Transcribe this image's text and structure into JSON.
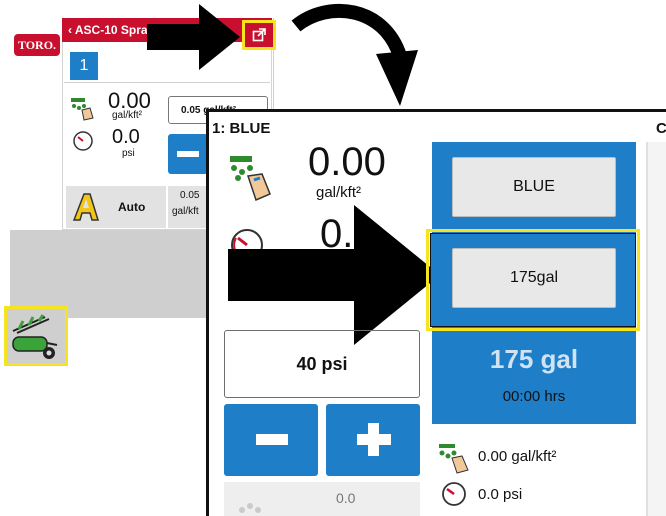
{
  "background_screen": {
    "logo_text": "TORO.",
    "header_title": "‹ ASC-10 Spray",
    "tab_number": "1",
    "rate_value": "0.00",
    "rate_unit": "gal/kft²",
    "pressure_value": "0.0",
    "pressure_unit": "psi",
    "target_rate": "0.05 gal/kft²",
    "auto_label": "Auto",
    "small_value": "0.05",
    "small_unit": "gal/kft"
  },
  "zoomed_panel": {
    "section_title": "1: BLUE",
    "next_section_title": "C",
    "rate_value": "0.00",
    "rate_unit": "gal/kft²",
    "pressure_value": "0.0",
    "target_pressure": "40 psi",
    "bottom_value": "0.0",
    "product_button": "BLUE",
    "tank_button": "175gal",
    "tank_level": "175 gal",
    "time_remaining": "00:00 hrs",
    "summary_rate": "0.00 gal/kft²",
    "summary_pressure": "0.0 psi"
  },
  "colors": {
    "brand_red": "#c8102e",
    "accent_blue": "#1e7fc8",
    "highlight_yellow": "#f5e41f"
  },
  "icons": [
    "popout-icon",
    "application-rate-icon",
    "pressure-gauge-icon",
    "auto-mode-icon",
    "boom-sprayer-icon",
    "minus-icon",
    "plus-icon"
  ]
}
